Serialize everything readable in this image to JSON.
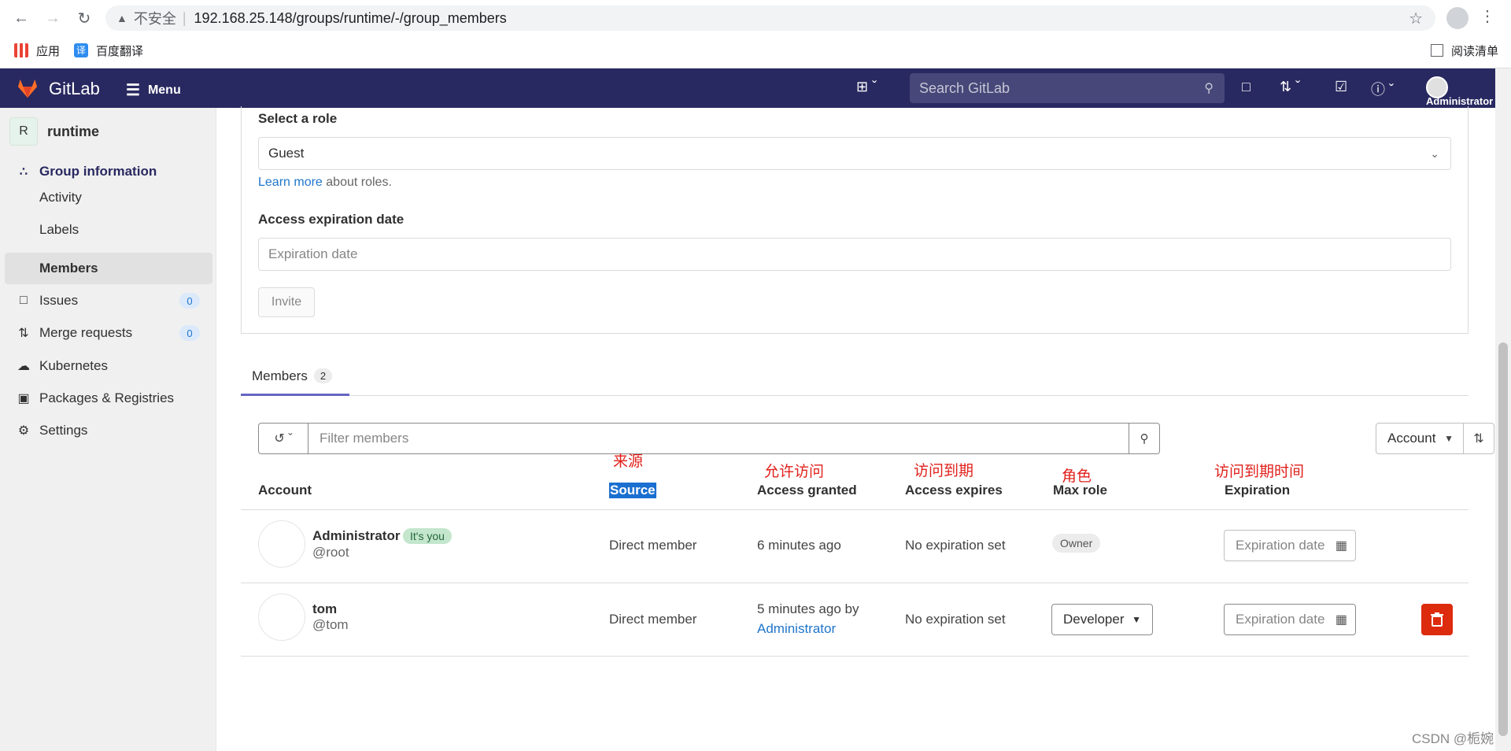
{
  "browser": {
    "insecure_label": "不安全",
    "url": "192.168.25.148/groups/runtime/-/group_members",
    "bookmarks": [
      "应用",
      "百度翻译"
    ],
    "reading_list": "阅读清单"
  },
  "header": {
    "brand": "GitLab",
    "menu": "Menu",
    "search_placeholder": "Search GitLab",
    "user": "Administrator"
  },
  "sidebar": {
    "context_initial": "R",
    "context_name": "runtime",
    "items": [
      {
        "label": "Group information"
      },
      {
        "label": "Activity"
      },
      {
        "label": "Labels"
      },
      {
        "label": "Members"
      },
      {
        "label": "Issues",
        "count": "0"
      },
      {
        "label": "Merge requests",
        "count": "0"
      },
      {
        "label": "Kubernetes"
      },
      {
        "label": "Packages & Registries"
      },
      {
        "label": "Settings"
      }
    ]
  },
  "invite": {
    "role_label": "Select a role",
    "role_value": "Guest",
    "learn_more": "Learn more",
    "learn_suffix": "about roles.",
    "expiration_label": "Access expiration date",
    "expiration_placeholder": "Expiration date",
    "invite_button": "Invite"
  },
  "tabs": {
    "members_label": "Members",
    "members_count": "2"
  },
  "filter": {
    "placeholder": "Filter members",
    "sort_label": "Account"
  },
  "annotations": {
    "source": "来源",
    "access_granted": "允许访问",
    "access_expires": "访问到期",
    "max_role": "角色",
    "expiration": "访问到期时间"
  },
  "table": {
    "headers": [
      "Account",
      "Source",
      "Access granted",
      "Access expires",
      "Max role",
      "Expiration"
    ],
    "rows": [
      {
        "name": "Administrator",
        "badge": "It's you",
        "username": "@root",
        "source": "Direct member",
        "granted": "6 minutes ago",
        "expires": "No expiration set",
        "role": "Owner",
        "expiration_placeholder": "Expiration date"
      },
      {
        "name": "tom",
        "username": "@tom",
        "source": "Direct member",
        "granted": "5 minutes ago by",
        "granted_by": "Administrator",
        "expires": "No expiration set",
        "role": "Developer",
        "expiration_placeholder": "Expiration date"
      }
    ]
  },
  "watermark": "CSDN @栀婉",
  "colors": {
    "header_bg": "#292961",
    "link": "#1f75cb",
    "danger": "#dd2b0e",
    "annotation": "#e0201b"
  }
}
